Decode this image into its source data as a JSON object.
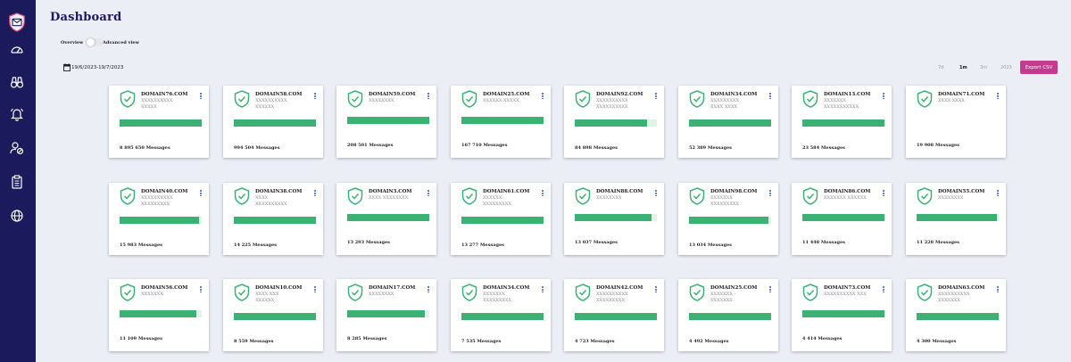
{
  "header": {
    "title": "Dashboard"
  },
  "view_toggle": {
    "left_label": "Overview",
    "right_label": "Advanced view",
    "advanced_on": false
  },
  "date_range": {
    "text": "19/6/2023-19/7/2023"
  },
  "ranges": [
    "7d",
    "1m",
    "3m",
    "2023"
  ],
  "active_range": "1m",
  "export_label": "Export CSV",
  "colors": {
    "sidebar": "#1b1a5c",
    "accent": "#c33a8f",
    "success": "#3bb273",
    "track": "#dff3e6",
    "link": "#3a5dc8"
  },
  "sidebar_icons": [
    "logo-mail-shield-icon",
    "speedometer-icon",
    "binoculars-icon",
    "bell-icon",
    "user-block-icon",
    "clipboard-icon",
    "globe-icon"
  ],
  "cards": [
    {
      "domain": "DOMAIN76.COM",
      "sub1": "XXXXXXXXXX",
      "sub2": "XXXXX",
      "progress": 1.0,
      "messages": "8 895 650 Messages"
    },
    {
      "domain": "DOMAIN58.COM",
      "sub1": "XXXXXXXXXX",
      "sub2": "XXXXXX",
      "progress": 1.0,
      "messages": "994 504 Messages"
    },
    {
      "domain": "DOMAIN59.COM",
      "sub1": "XXXXXXXX",
      "sub2": "",
      "progress": 1.0,
      "messages": "208 501 Messages"
    },
    {
      "domain": "DOMAIN25.COM",
      "sub1": "XXXXXX XXXXX",
      "sub2": "",
      "progress": 1.0,
      "messages": "167 710 Messages"
    },
    {
      "domain": "DOMAIN92.COM",
      "sub1": "XXXXXXXXXX",
      "sub2": "XXXXXXXXXX",
      "progress": 0.88,
      "messages": "84 898 Messages"
    },
    {
      "domain": "DOMAIN34.COM",
      "sub1": "XXXXXXXXX",
      "sub2": "XXXX XXXX",
      "progress": 1.0,
      "messages": "52 389 Messages"
    },
    {
      "domain": "DOMAIN13.COM",
      "sub1": "XXXXXXX",
      "sub2": "XXXXXXXXXXX",
      "progress": 1.0,
      "messages": "23 584 Messages"
    },
    {
      "domain": "DOMAIN71.COM",
      "sub1": "XXXX-XXXX",
      "sub2": "",
      "progress": 0.0,
      "messages": "19 908 Messages"
    },
    {
      "domain": "DOMAIN40.COM",
      "sub1": "XXXXXXXXXX",
      "sub2": "XXXXXXXXX",
      "progress": 0.97,
      "messages": "15 983 Messages"
    },
    {
      "domain": "DOMAIN38.COM",
      "sub1": "XXXX",
      "sub2": "XXXXXXXXXX",
      "progress": 1.0,
      "messages": "14 225 Messages"
    },
    {
      "domain": "DOMAIN3.COM",
      "sub1": "XXXX XXXXXXXX",
      "sub2": "",
      "progress": 1.0,
      "messages": "13 293 Messages"
    },
    {
      "domain": "DOMAIN61.COM",
      "sub1": "XXXXXX",
      "sub2": "XXXXXXXXX",
      "progress": 1.0,
      "messages": "13 277 Messages"
    },
    {
      "domain": "DOMAIN88.COM",
      "sub1": "XXXXXXXX",
      "sub2": "",
      "progress": 0.94,
      "messages": "13 037 Messages"
    },
    {
      "domain": "DOMAIN98.COM",
      "sub1": "XXXXXXX",
      "sub2": "XXXXXXXXX",
      "progress": 0.97,
      "messages": "13 034 Messages"
    },
    {
      "domain": "DOMAIN86.COM",
      "sub1": "XXXXXXX XXXXXX",
      "sub2": "",
      "progress": 1.0,
      "messages": "11 448 Messages"
    },
    {
      "domain": "DOMAIN55.COM",
      "sub1": "XXXXXXXX",
      "sub2": "",
      "progress": 0.98,
      "messages": "11 228 Messages"
    },
    {
      "domain": "DOMAIN56.COM",
      "sub1": "XXXXXXX",
      "sub2": "",
      "progress": 0.94,
      "messages": "11 109 Messages"
    },
    {
      "domain": "DOMAIN10.COM",
      "sub1": "XXXX XXX",
      "sub2": "XXXXXX",
      "progress": 1.0,
      "messages": "8 559 Messages"
    },
    {
      "domain": "DOMAIN17.COM",
      "sub1": "XXXXXXXX",
      "sub2": "",
      "progress": 0.95,
      "messages": "8 285 Messages"
    },
    {
      "domain": "DOMAIN34.COM",
      "sub1": "XXXXXXX",
      "sub2": "XXXXXXXXX",
      "progress": 1.0,
      "messages": "7 535 Messages"
    },
    {
      "domain": "DOMAIN42.COM",
      "sub1": "XXXXXXXXXX",
      "sub2": "XXXXXXXXX",
      "progress": 1.0,
      "messages": "4 723 Messages"
    },
    {
      "domain": "DOMAIN25.COM",
      "sub1": "XXXXXXX -",
      "sub2": "XXXXXXX",
      "progress": 1.0,
      "messages": "4 492 Messages"
    },
    {
      "domain": "DOMAIN73.COM",
      "sub1": "XXXXXXXXXX XXX",
      "sub2": "",
      "progress": 1.0,
      "messages": "4 414 Messages"
    },
    {
      "domain": "DOMAIN63.COM",
      "sub1": "XXXXXXXXXX",
      "sub2": "XXXXXXX",
      "progress": 1.0,
      "messages": "4 300 Messages"
    }
  ]
}
